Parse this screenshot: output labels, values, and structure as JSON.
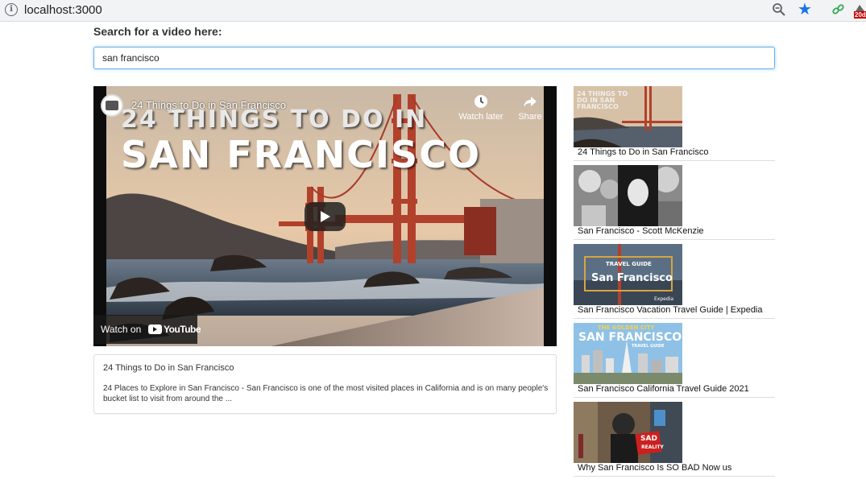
{
  "browser": {
    "url": "localhost:3000",
    "badge": "20d"
  },
  "search": {
    "label": "Search for a video here:",
    "value": "san francisco"
  },
  "player": {
    "video_title": "24 Things to Do in San Francisco",
    "thumbnail_line1": "24 THINGS TO DO IN",
    "thumbnail_line2": "SAN FRANCISCO",
    "watch_later_label": "Watch later",
    "share_label": "Share",
    "watch_on_label": "Watch on",
    "youtube_wordmark": "YouTube"
  },
  "description": {
    "title": "24 Things to Do in San Francisco",
    "body": "24 Places to Explore in San Francisco - San Francisco is one of the most visited places in California and is on many people's bucket list to visit from around the ..."
  },
  "video_list": {
    "items": [
      {
        "title": "24 Things to Do in San Francisco",
        "thumb_text": "24 THINGS TO DO IN SAN FRANCISCO"
      },
      {
        "title": "San Francisco - Scott McKenzie",
        "thumb_text": ""
      },
      {
        "title": "San Francisco Vacation Travel Guide | Expedia",
        "thumb_text_top": "TRAVEL GUIDE",
        "thumb_text_main": "San Francisco",
        "thumb_brand": "Expedia"
      },
      {
        "title": "San Francisco California Travel Guide 2021",
        "thumb_text_top": "THE GOLDEN CITY",
        "thumb_text_main": "SAN FRANCISCO",
        "thumb_text_sub": "TRAVEL GUIDE"
      },
      {
        "title": "Why San Francisco Is SO BAD Now us",
        "thumb_text_main": "SAD",
        "thumb_text_sub": "REALITY"
      }
    ]
  },
  "colors": {
    "input_focus_border": "#66afe9",
    "bookmark_star": "#1a73e8",
    "divider": "#dddddd"
  }
}
